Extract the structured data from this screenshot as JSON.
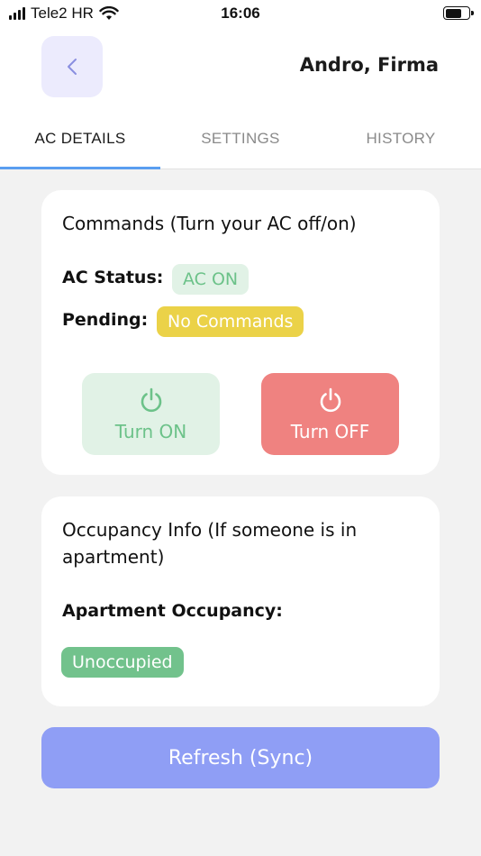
{
  "status_bar": {
    "carrier": "Tele2 HR",
    "time": "16:06"
  },
  "header": {
    "title": "Andro, Firma"
  },
  "tabs": [
    {
      "label": "AC DETAILS",
      "active": true
    },
    {
      "label": "SETTINGS",
      "active": false
    },
    {
      "label": "HISTORY",
      "active": false
    }
  ],
  "commands": {
    "title": "Commands (Turn your AC off/on)",
    "status_label": "AC Status:",
    "status_value": "AC ON",
    "pending_label": "Pending:",
    "pending_value": "No Commands",
    "turn_on_label": "Turn ON",
    "turn_off_label": "Turn OFF"
  },
  "occupancy": {
    "title_line1": "Occupancy Info (If someone is in",
    "title_line2": "apartment)",
    "label": "Apartment Occupancy:",
    "value": "Unoccupied"
  },
  "refresh_label": "Refresh (Sync)",
  "colors": {
    "tab_indicator": "#5a9ef0",
    "status_green": "#6cc289",
    "pending_yellow": "#ebd248",
    "turn_off_red": "#ef8280",
    "refresh_blue": "#8f9ef5"
  },
  "icons": [
    "cellular-signal-icon",
    "wifi-icon",
    "battery-icon",
    "chevron-left-icon",
    "power-icon"
  ]
}
